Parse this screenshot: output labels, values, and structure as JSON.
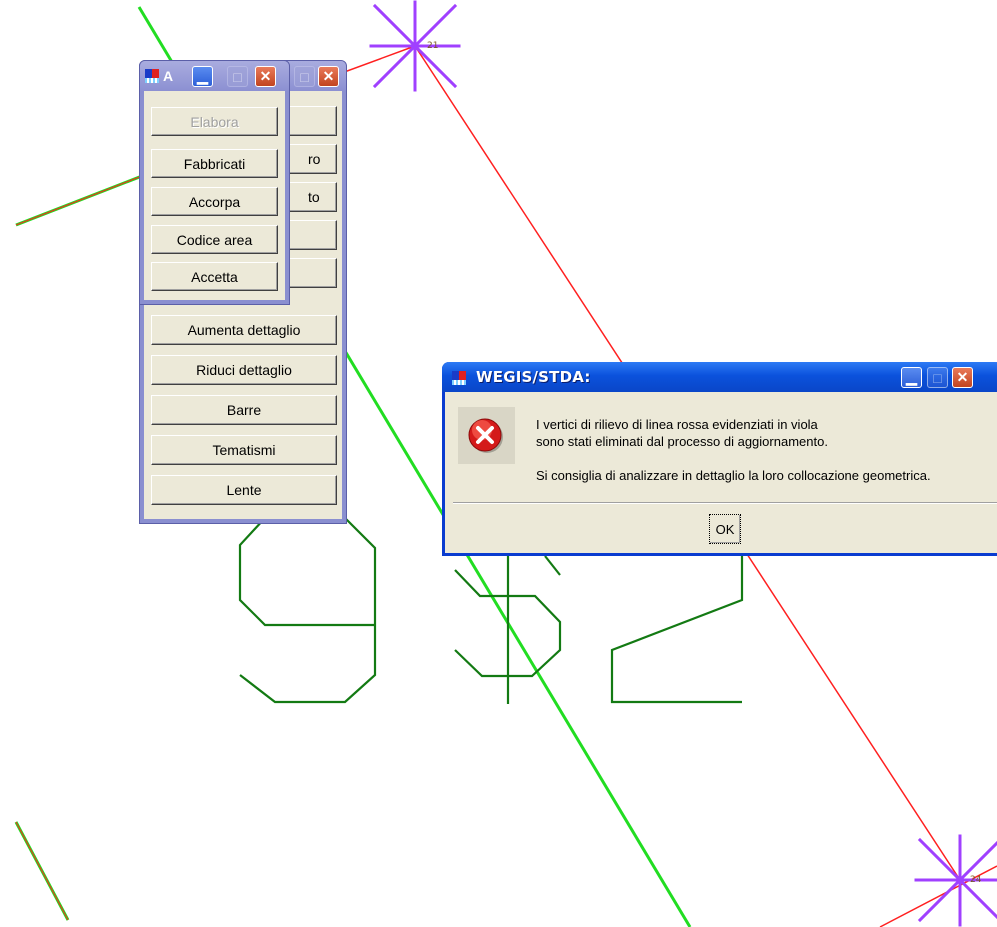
{
  "map": {
    "colors": {
      "green": "#22dd22",
      "dark_green": "#137a13",
      "red": "#ff2020",
      "purple": "#a040ff"
    },
    "vertex_labels": [
      "21",
      "24"
    ],
    "parcel_number_glyphs": [
      "9",
      "$",
      "2"
    ]
  },
  "palette_back": {
    "title": "",
    "buttons_clipped": [
      {
        "label": ""
      },
      {
        "label": "ro"
      },
      {
        "label": "to"
      },
      {
        "label": ""
      },
      {
        "label": ""
      }
    ],
    "buttons": [
      {
        "label": "Aumenta dettaglio"
      },
      {
        "label": "Riduci dettaglio"
      },
      {
        "label": "Barre"
      },
      {
        "label": "Tematismi"
      },
      {
        "label": "Lente"
      }
    ]
  },
  "palette_front": {
    "title": "A",
    "buttons": [
      {
        "label": "Elabora",
        "disabled": true
      },
      {
        "label": "Fabbricati"
      },
      {
        "label": "Accorpa"
      },
      {
        "label": "Codice area"
      },
      {
        "label": "Accetta"
      }
    ]
  },
  "dialog": {
    "title": "WEGIS/STDA:",
    "icon": "error-icon",
    "message_lines": [
      "I vertici di rilievo di linea rossa evidenziati in viola",
      "sono stati eliminati dal processo di aggiornamento.",
      "",
      "Si consiglia di analizzare in dettaglio la loro collocazione geometrica."
    ],
    "ok_label": "OK"
  }
}
